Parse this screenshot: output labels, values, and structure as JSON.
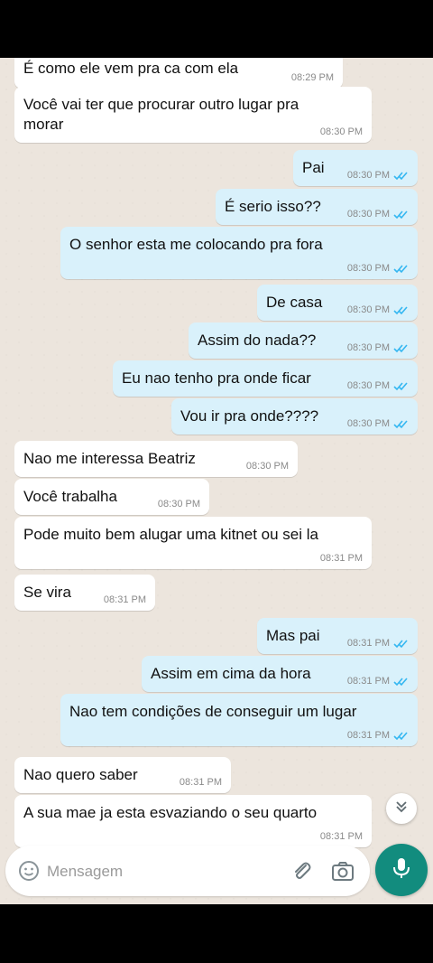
{
  "messages": [
    {
      "dir": "in",
      "text": "É como ele vem pra ca com ela",
      "time": "08:29 PM"
    },
    {
      "dir": "in",
      "text": "Você vai ter que procurar outro lugar pra morar",
      "time": "08:30 PM"
    },
    {
      "dir": "out",
      "text": "Pai",
      "time": "08:30 PM"
    },
    {
      "dir": "out",
      "text": "É serio isso??",
      "time": "08:30 PM"
    },
    {
      "dir": "out",
      "text": "O senhor esta me colocando pra fora",
      "time": "08:30 PM"
    },
    {
      "dir": "out",
      "text": "De casa",
      "time": "08:30 PM"
    },
    {
      "dir": "out",
      "text": "Assim do nada??",
      "time": "08:30 PM"
    },
    {
      "dir": "out",
      "text": "Eu nao tenho pra onde ficar",
      "time": "08:30 PM"
    },
    {
      "dir": "out",
      "text": "Vou ir pra onde????",
      "time": "08:30 PM"
    },
    {
      "dir": "in",
      "text": "Nao me interessa Beatriz",
      "time": "08:30 PM"
    },
    {
      "dir": "in",
      "text": "Você trabalha",
      "time": "08:30 PM"
    },
    {
      "dir": "in",
      "text": "Pode muito bem alugar uma kitnet ou sei la",
      "time": "08:31 PM"
    },
    {
      "dir": "in",
      "text": "Se vira",
      "time": "08:31 PM"
    },
    {
      "dir": "out",
      "text": "Mas pai",
      "time": "08:31 PM"
    },
    {
      "dir": "out",
      "text": "Assim em cima da hora",
      "time": "08:31 PM"
    },
    {
      "dir": "out",
      "text": "Nao tem condições de conseguir um lugar",
      "time": "08:31 PM"
    },
    {
      "dir": "in",
      "text": "Nao quero saber",
      "time": "08:31 PM"
    },
    {
      "dir": "in",
      "text": "A sua mae ja esta esvaziando o seu quarto",
      "time": "08:31 PM"
    }
  ],
  "composer": {
    "placeholder": "Mensagem"
  },
  "colors": {
    "incoming": "#ffffff",
    "outgoing": "#d9f1fb",
    "accent": "#128c7e",
    "ticks": "#34b7f1"
  },
  "icons": {
    "emoji": "emoji-icon",
    "attach": "paperclip-icon",
    "camera": "camera-icon",
    "mic": "microphone-icon",
    "scroll": "double-chevron-down-icon"
  }
}
